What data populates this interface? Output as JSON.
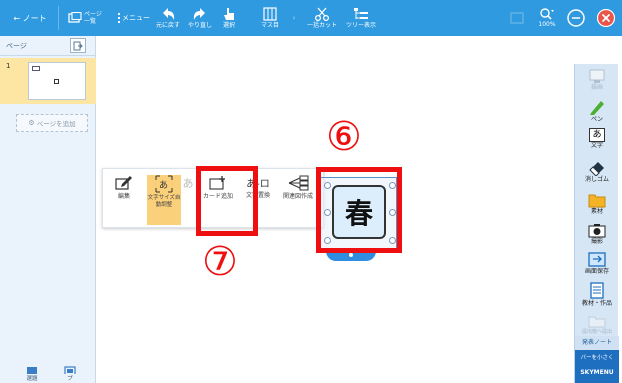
{
  "toolbar": {
    "back_label": "← ノート",
    "page_list_label_1": "ページ",
    "page_list_label_2": "一覧",
    "menu_label": "メニュー",
    "undo_label": "元に戻す",
    "redo_label": "やり直し",
    "select_label": "選択",
    "grid_label": "マス目",
    "batch_cut_label": "一括カット",
    "tree_label": "ツリー表示",
    "zoom_label": "100%",
    "accent_color": "#2f9ae0",
    "close_color": "#e8554a"
  },
  "left_panel": {
    "title": "ページ",
    "thumbnail_number": "1",
    "add_page_label": "ページを追加",
    "bottom_left_label": "選題",
    "bottom_right_label": "プ"
  },
  "right_panel": {
    "items": [
      {
        "label": "描画",
        "icon": "monitor-icon",
        "enabled": false
      },
      {
        "label": "ペン",
        "icon": "pen-icon",
        "enabled": true
      },
      {
        "label": "文字",
        "icon": "text-icon",
        "enabled": true
      },
      {
        "label": "消しゴム",
        "icon": "eraser-icon",
        "enabled": true
      },
      {
        "label": "素材",
        "icon": "folder-icon",
        "enabled": true
      },
      {
        "label": "撮影",
        "icon": "camera-icon",
        "enabled": true
      },
      {
        "label": "画面保存",
        "icon": "screen-save-icon",
        "enabled": true
      },
      {
        "label": "教材・作品",
        "icon": "document-icon",
        "enabled": true
      },
      {
        "label": "提出箱へ提出",
        "icon": "submit-icon",
        "enabled": false
      }
    ],
    "note_label": "発表ノート",
    "brand_sub": "バーを小さく",
    "brand_name": "SKYMENU"
  },
  "popup_toolbar": {
    "items": [
      {
        "label": "編集",
        "icon": "edit-icon",
        "active": false
      },
      {
        "label": "文字サイズ自動調整",
        "icon": "text-autosize-icon",
        "active": true
      },
      {
        "label": "カード追加",
        "icon": "add-card-icon",
        "active": false
      },
      {
        "label": "文字置換",
        "icon": "text-replace-icon",
        "active": false
      },
      {
        "label": "関連図作成",
        "icon": "diagram-icon",
        "active": false
      }
    ],
    "faded_chars": [
      "あ",
      "あ"
    ]
  },
  "card": {
    "text": "春",
    "fill": "#dceefb"
  },
  "annotations": {
    "label_6": "⑥",
    "label_7": "⑦",
    "color": "#ee1010"
  }
}
